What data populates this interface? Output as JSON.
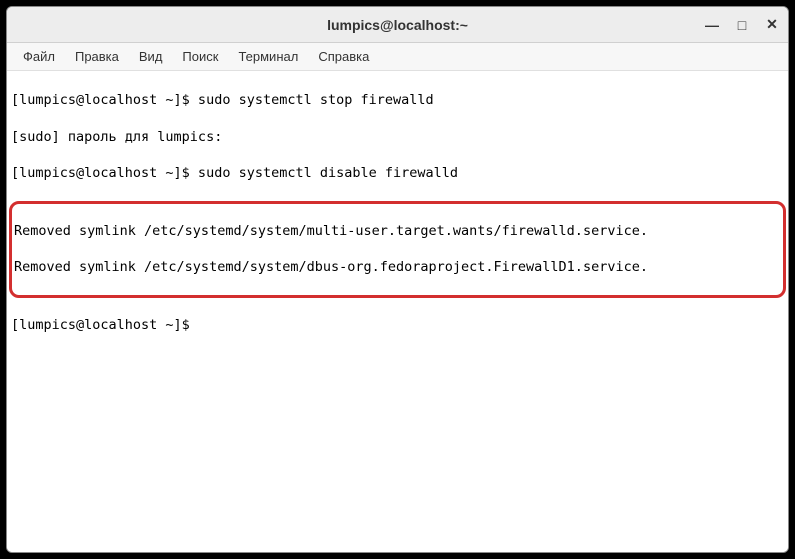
{
  "titlebar": {
    "title": "lumpics@localhost:~"
  },
  "window_controls": {
    "minimize": "—",
    "maximize": "□",
    "close": "✕"
  },
  "menubar": {
    "items": [
      {
        "label": "Файл"
      },
      {
        "label": "Правка"
      },
      {
        "label": "Вид"
      },
      {
        "label": "Поиск"
      },
      {
        "label": "Терминал"
      },
      {
        "label": "Справка"
      }
    ]
  },
  "terminal": {
    "lines": {
      "l1": "[lumpics@localhost ~]$ sudo systemctl stop firewalld",
      "l2": "[sudo] пароль для lumpics:",
      "l3": "[lumpics@localhost ~]$ sudo systemctl disable firewalld",
      "h1": "Removed symlink /etc/systemd/system/multi-user.target.wants/firewalld.service.",
      "h2": "Removed symlink /etc/systemd/system/dbus-org.fedoraproject.FirewallD1.service.",
      "l4": "[lumpics@localhost ~]$ "
    }
  }
}
